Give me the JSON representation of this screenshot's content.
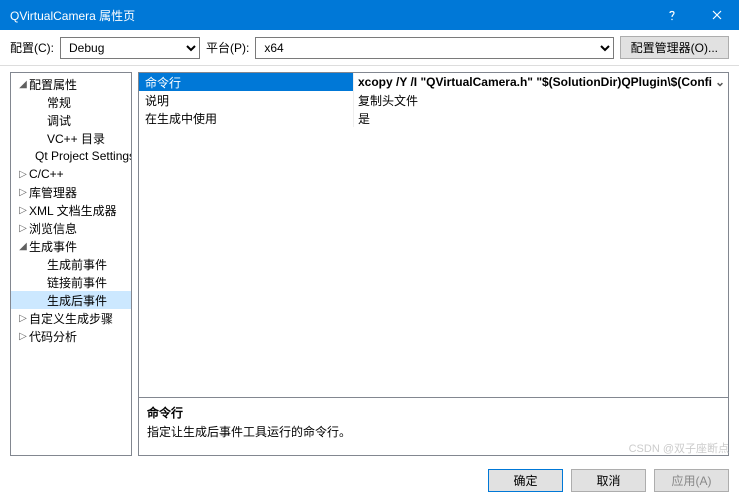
{
  "titlebar": {
    "title": "QVirtualCamera 属性页"
  },
  "toolbar": {
    "config_label": "配置(C):",
    "config_value": "Debug",
    "platform_label": "平台(P):",
    "platform_value": "x64",
    "manager_label": "配置管理器(O)..."
  },
  "tree": {
    "root": "配置属性",
    "items": [
      {
        "label": "常规",
        "lvl": 2,
        "exp": null
      },
      {
        "label": "调试",
        "lvl": 2,
        "exp": null
      },
      {
        "label": "VC++ 目录",
        "lvl": 2,
        "exp": null
      },
      {
        "label": "Qt Project Settings",
        "lvl": 2,
        "exp": null
      },
      {
        "label": "C/C++",
        "lvl": 1,
        "exp": false
      },
      {
        "label": "库管理器",
        "lvl": 1,
        "exp": false
      },
      {
        "label": "XML 文档生成器",
        "lvl": 1,
        "exp": false
      },
      {
        "label": "浏览信息",
        "lvl": 1,
        "exp": false
      },
      {
        "label": "生成事件",
        "lvl": 1,
        "exp": true
      },
      {
        "label": "生成前事件",
        "lvl": 2,
        "exp": null
      },
      {
        "label": "链接前事件",
        "lvl": 2,
        "exp": null
      },
      {
        "label": "生成后事件",
        "lvl": 2,
        "exp": null,
        "sel": true
      },
      {
        "label": "自定义生成步骤",
        "lvl": 1,
        "exp": false
      },
      {
        "label": "代码分析",
        "lvl": 1,
        "exp": false
      }
    ]
  },
  "grid": {
    "rows": [
      {
        "k": "命令行",
        "v": "xcopy /Y /I \"QVirtualCamera.h\" \"$(SolutionDir)QPlugin\\$(Confi",
        "sel": true,
        "dd": true
      },
      {
        "k": "说明",
        "v": "复制头文件"
      },
      {
        "k": "在生成中使用",
        "v": "是"
      }
    ]
  },
  "desc": {
    "title": "命令行",
    "text": "指定让生成后事件工具运行的命令行。"
  },
  "footer": {
    "ok": "确定",
    "cancel": "取消",
    "apply": "应用(A)"
  },
  "watermark": "CSDN @双子座断点"
}
